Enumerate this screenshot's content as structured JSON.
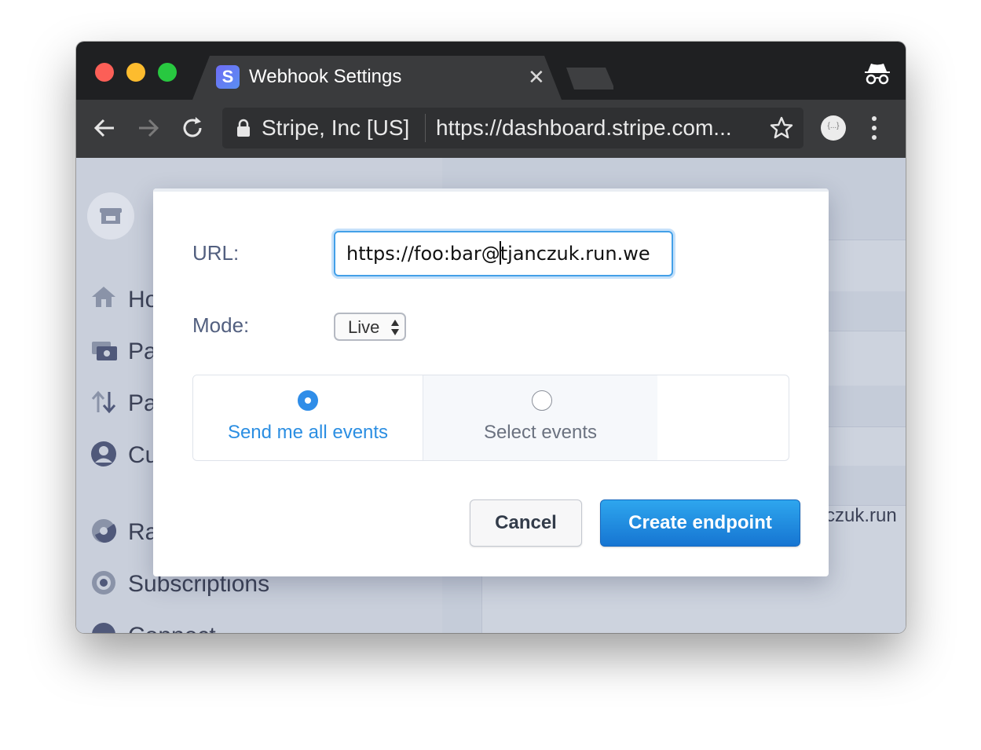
{
  "browser": {
    "tab_title": "Webhook Settings",
    "favicon_letter": "S",
    "site_identity": "Stripe, Inc [US]",
    "url_scheme": "https://",
    "url_rest": "dashboard.stripe.com...",
    "extension_label": "{...}"
  },
  "sidebar": {
    "items": [
      {
        "label": "Ho",
        "icon": "home-icon"
      },
      {
        "label": "Pa",
        "icon": "payments-icon"
      },
      {
        "label": "Pa",
        "icon": "payouts-icon"
      },
      {
        "label": "Cu",
        "icon": "customer-icon"
      },
      {
        "label": "Ra",
        "icon": "radar-icon"
      },
      {
        "label": "Subscriptions",
        "icon": "subscriptions-icon"
      },
      {
        "label": "Connect",
        "icon": "connect-icon"
      }
    ]
  },
  "background_peek_text": "czuk.run",
  "modal": {
    "url_label": "URL:",
    "url_value_before_caret": "https://foo:bar@",
    "url_value_after_caret": "tjanczuk.run.we",
    "mode_label": "Mode:",
    "mode_value": "Live",
    "event_options": [
      {
        "label": "Send me all events",
        "selected": true
      },
      {
        "label": "Select events",
        "selected": false
      }
    ],
    "cancel_label": "Cancel",
    "create_label": "Create endpoint"
  },
  "colors": {
    "accent": "#2b8ee2",
    "primary_button": "#1a87dc",
    "traffic_red": "#fc5f57",
    "traffic_yellow": "#fdbc2e",
    "traffic_green": "#28c840"
  }
}
